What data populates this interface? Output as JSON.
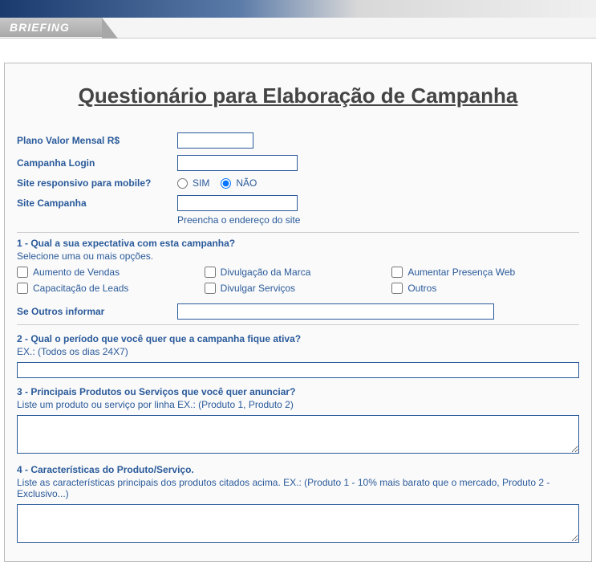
{
  "header": {
    "tab": "BRIEFING"
  },
  "title": "Questionário para Elaboração de Campanha",
  "fields": {
    "plano_label": "Plano Valor Mensal R$",
    "plano_value": "",
    "login_label": "Campanha Login",
    "login_value": "",
    "responsive_label": "Site responsivo para mobile?",
    "responsive_sim": "SIM",
    "responsive_nao": "NÃO",
    "responsive_value": "NAO",
    "site_label": "Site Campanha",
    "site_value": "",
    "site_hint": "Preencha o endereço do site"
  },
  "q1": {
    "label": "1 - Qual a sua expectativa com esta campanha?",
    "hint": "Selecione uma ou mais opções.",
    "options": {
      "a": "Aumento de Vendas",
      "b": "Divulgação da Marca",
      "c": "Aumentar Presença Web",
      "d": "Capacitação de Leads",
      "e": "Divulgar Serviços",
      "f": "Outros"
    },
    "outros_label": "Se Outros informar",
    "outros_value": ""
  },
  "q2": {
    "label": "2 - Qual o período que você quer que a campanha fique ativa?",
    "hint": "EX.: (Todos os dias 24X7)",
    "value": ""
  },
  "q3": {
    "label": "3 - Principais Produtos ou Serviços que você quer anunciar?",
    "hint": "Liste um produto ou serviço por linha EX.: (Produto 1, Produto 2)",
    "value": ""
  },
  "q4": {
    "label": "4 - Características do Produto/Serviço.",
    "hint": "Liste as características principais dos produtos citados acima. EX.: (Produto 1 - 10% mais barato que o mercado, Produto 2 - Exclusivo...)",
    "value": ""
  }
}
